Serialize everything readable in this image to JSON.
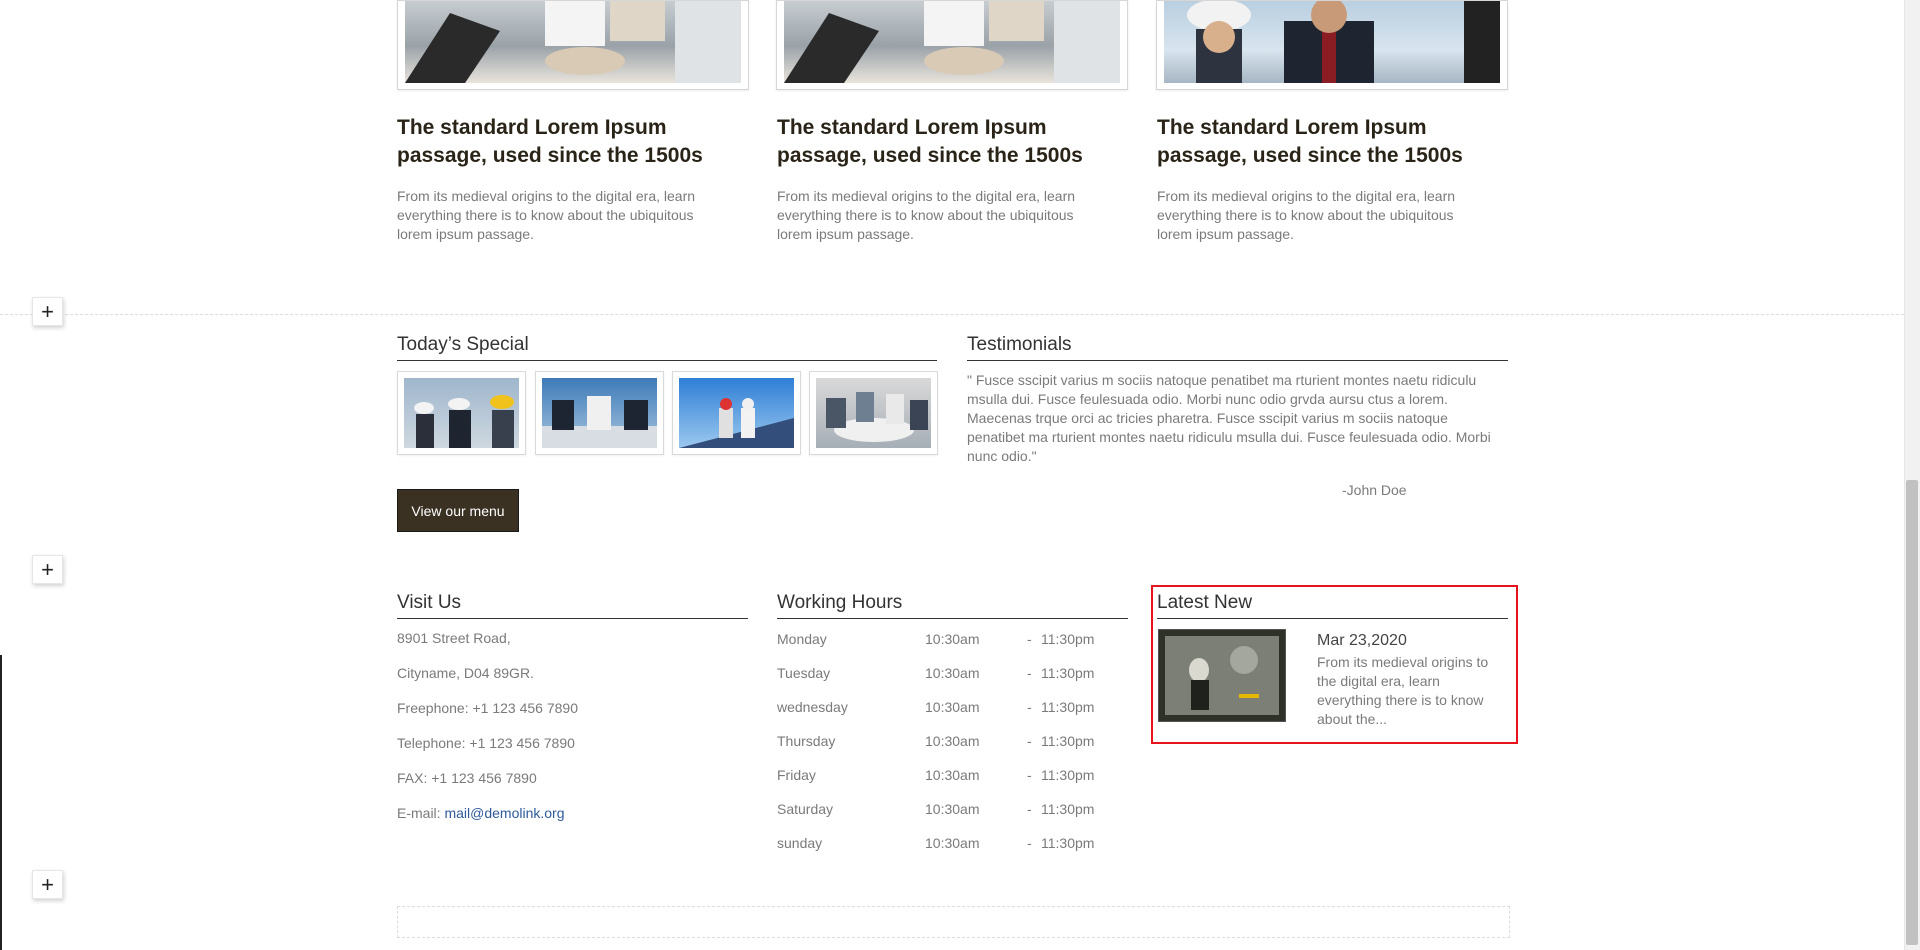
{
  "cards": [
    {
      "title": "The standard Lorem Ipsum passage, used since the 1500s",
      "text": "From its medieval origins to the digital era, learn everything there is to know about the ubiquitous lorem ipsum passage."
    },
    {
      "title": "The standard Lorem Ipsum passage, used since the 1500s",
      "text": "From its medieval origins to the digital era, learn everything there is to know about the ubiquitous lorem ipsum passage."
    },
    {
      "title": "The standard Lorem Ipsum passage, used since the 1500s",
      "text": "From its medieval origins to the digital era, learn everything there is to know about the ubiquitous lorem ipsum passage."
    }
  ],
  "controls": {
    "plus": "+"
  },
  "special": {
    "title": "Today’s Special",
    "button": "View our menu"
  },
  "testimonials": {
    "title": "Testimonials",
    "quote": "\" Fusce sscipit varius m sociis natoque penatibet ma rturient montes naetu ridiculu msulla dui. Fusce feulesuada odio. Morbi nunc odio grvda aursu ctus a lorem. Maecenas trque orci ac tricies pharetra. Fusce sscipit varius m sociis natoque penatibet ma rturient montes naetu ridiculu msulla dui. Fusce feulesuada odio. Morbi nunc odio.\"",
    "author": "-John Doe"
  },
  "visit": {
    "title": "Visit Us",
    "line1": "8901 Street Road,",
    "line2": "Cityname, D04 89GR.",
    "freephone": "Freephone: +1 123 456 7890",
    "telephone": "Telephone: +1 123 456 7890",
    "fax": "FAX: +1 123 456 7890",
    "email_label": "E-mail:",
    "email": "mail@demolink.org"
  },
  "hours": {
    "title": "Working Hours",
    "rows": [
      {
        "day": "Monday",
        "open": "10:30am",
        "dash": "-",
        "close": "11:30pm"
      },
      {
        "day": "Tuesday",
        "open": "10:30am",
        "dash": "-",
        "close": "11:30pm"
      },
      {
        "day": "wednesday",
        "open": "10:30am",
        "dash": "-",
        "close": "11:30pm"
      },
      {
        "day": "Thursday",
        "open": "10:30am",
        "dash": "-",
        "close": "11:30pm"
      },
      {
        "day": "Friday",
        "open": "10:30am",
        "dash": "-",
        "close": "11:30pm"
      },
      {
        "day": "Saturday",
        "open": "10:30am",
        "dash": "-",
        "close": "11:30pm"
      },
      {
        "day": "sunday",
        "open": "10:30am",
        "dash": "-",
        "close": "11:30pm"
      }
    ]
  },
  "news": {
    "title": "Latest New",
    "date": "Mar 23,2020",
    "text": "From its medieval origins to the digital era, learn everything there is to know about the..."
  }
}
